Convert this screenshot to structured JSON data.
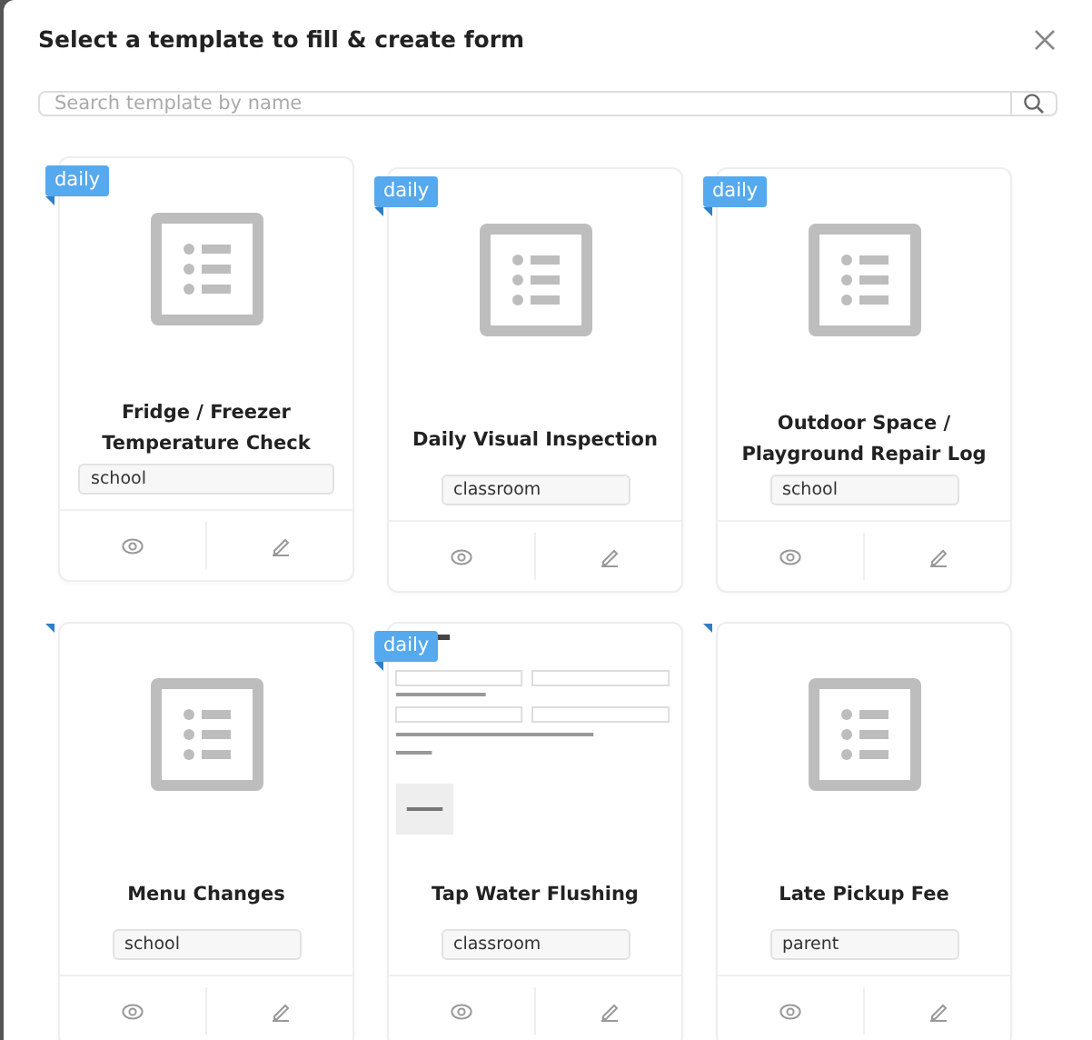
{
  "dialog": {
    "title": "Select a template to fill & create form"
  },
  "search": {
    "placeholder": "Search template by name"
  },
  "templates": [
    {
      "kind": "icon",
      "badge": "daily",
      "title": "Fridge / Freezer Temperature Check",
      "tag": "school"
    },
    {
      "kind": "icon",
      "badge": "daily",
      "title": "Daily Visual Inspection",
      "tag": "classroom"
    },
    {
      "kind": "icon",
      "badge": "daily",
      "title": "Outdoor Space / Playground Repair Log",
      "tag": "school"
    },
    {
      "kind": "icon",
      "title": "Menu Changes",
      "tag": "school"
    },
    {
      "kind": "preview",
      "badge": "daily",
      "title": "Tap Water Flushing",
      "tag": "classroom"
    },
    {
      "kind": "icon",
      "title": "Late Pickup Fee",
      "tag": "parent"
    }
  ]
}
